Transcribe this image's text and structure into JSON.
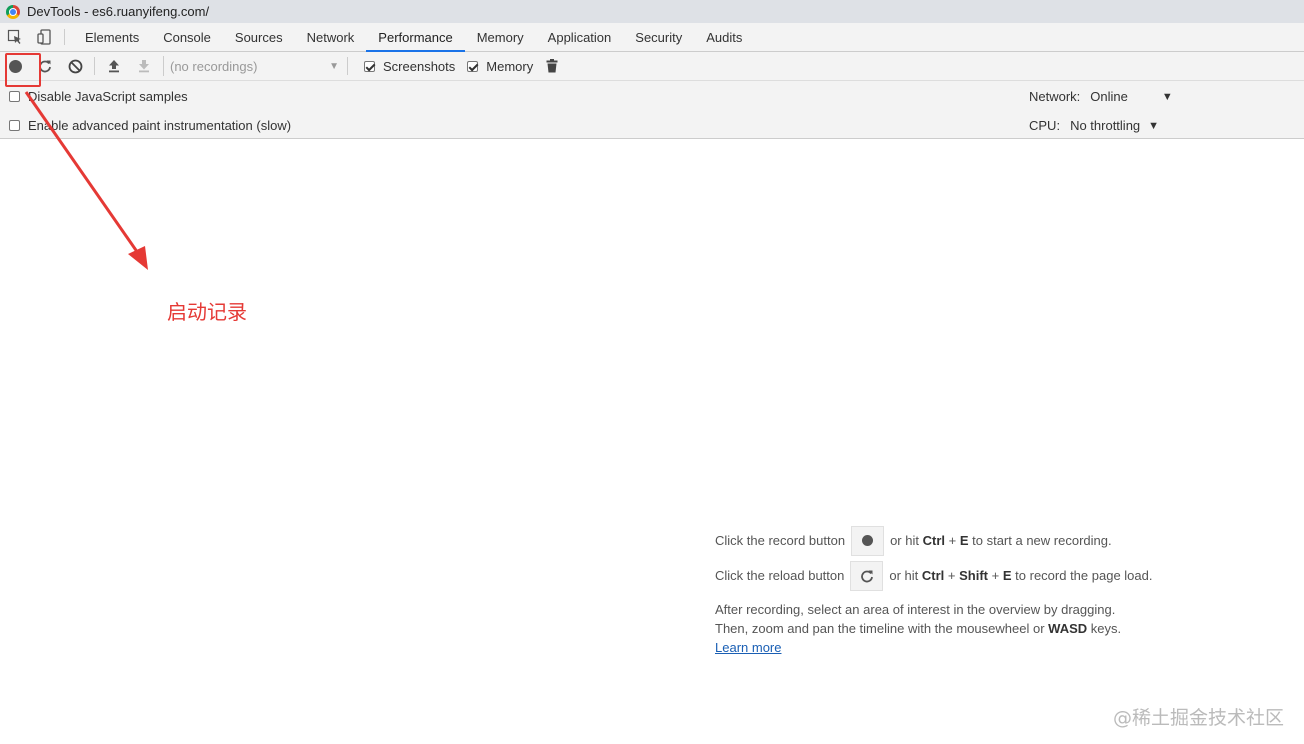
{
  "window": {
    "title": "DevTools - es6.ruanyifeng.com/"
  },
  "tabs": [
    {
      "label": "Elements"
    },
    {
      "label": "Console"
    },
    {
      "label": "Sources"
    },
    {
      "label": "Network"
    },
    {
      "label": "Performance",
      "active": true
    },
    {
      "label": "Memory"
    },
    {
      "label": "Application"
    },
    {
      "label": "Security"
    },
    {
      "label": "Audits"
    }
  ],
  "toolbar": {
    "recordings_placeholder": "(no recordings)",
    "screenshots_label": "Screenshots",
    "screenshots_checked": true,
    "memory_label": "Memory",
    "memory_checked": true
  },
  "settings": {
    "disable_js_samples": "Disable JavaScript samples",
    "advanced_paint": "Enable advanced paint instrumentation (slow)",
    "network_label": "Network:",
    "network_value": "Online",
    "cpu_label": "CPU:",
    "cpu_value": "No throttling"
  },
  "annotation": {
    "text": "启动记录",
    "color": "#e53935"
  },
  "landing": {
    "record_prefix": "Click the record button",
    "record_mid": "or hit",
    "record_key1": "Ctrl",
    "record_plus": "+",
    "record_key2": "E",
    "record_suffix": "to start a new recording.",
    "reload_prefix": "Click the reload button",
    "reload_mid": "or hit",
    "reload_key1": "Ctrl",
    "reload_plus1": "+",
    "reload_key2": "Shift",
    "reload_plus2": "+",
    "reload_key3": "E",
    "reload_suffix": "to record the page load.",
    "para_line1": "After recording, select an area of interest in the overview by dragging.",
    "para_line2_a": "Then, zoom and pan the timeline with the mousewheel or",
    "para_line2_key": "WASD",
    "para_line2_b": "keys.",
    "learn_more": "Learn more"
  },
  "watermark": "@稀土掘金技术社区",
  "colors": {
    "accent": "#1a73e8",
    "annotation": "#e53935",
    "toolbar_bg": "#f3f3f3"
  }
}
